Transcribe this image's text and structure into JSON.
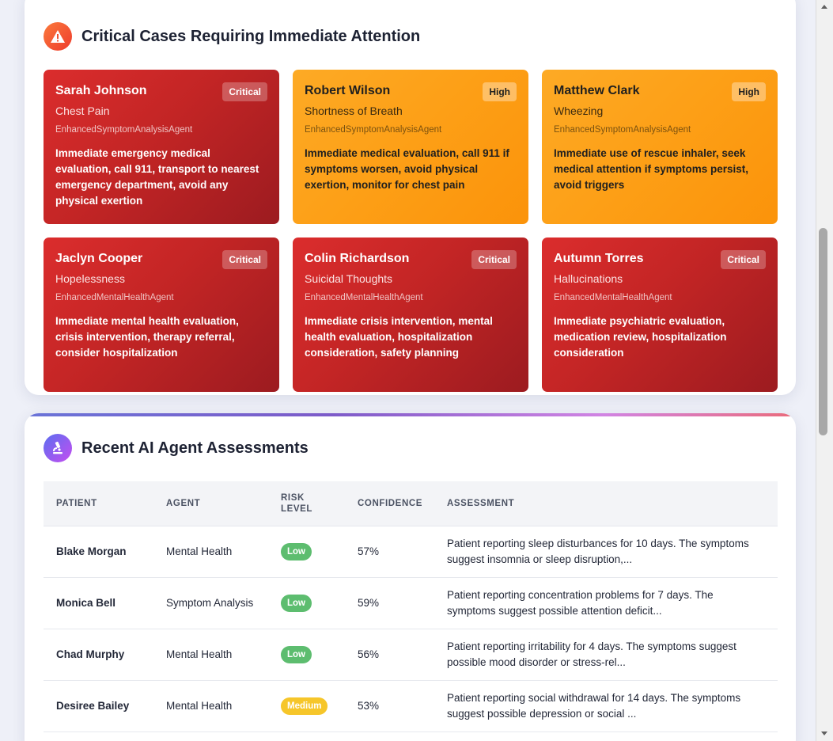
{
  "critical_panel": {
    "title": "Critical Cases Requiring Immediate Attention",
    "icon": "warning-icon",
    "cases": [
      {
        "name": "Sarah Johnson",
        "badge": "Critical",
        "symptom": "Chest Pain",
        "agent": "EnhancedSymptomAnalysisAgent",
        "action": "Immediate emergency medical evaluation, call 911, transport to nearest emergency department, avoid any physical exertion"
      },
      {
        "name": "Robert Wilson",
        "badge": "High",
        "symptom": "Shortness of Breath",
        "agent": "EnhancedSymptomAnalysisAgent",
        "action": "Immediate medical evaluation, call 911 if symptoms worsen, avoid physical exertion, monitor for chest pain"
      },
      {
        "name": "Matthew Clark",
        "badge": "High",
        "symptom": "Wheezing",
        "agent": "EnhancedSymptomAnalysisAgent",
        "action": "Immediate use of rescue inhaler, seek medical attention if symptoms persist, avoid triggers"
      },
      {
        "name": "Jaclyn Cooper",
        "badge": "Critical",
        "symptom": "Hopelessness",
        "agent": "EnhancedMentalHealthAgent",
        "action": "Immediate mental health evaluation, crisis intervention, therapy referral, consider hospitalization"
      },
      {
        "name": "Colin Richardson",
        "badge": "Critical",
        "symptom": "Suicidal Thoughts",
        "agent": "EnhancedMentalHealthAgent",
        "action": "Immediate crisis intervention, mental health evaluation, hospitalization consideration, safety planning"
      },
      {
        "name": "Autumn Torres",
        "badge": "Critical",
        "symptom": "Hallucinations",
        "agent": "EnhancedMentalHealthAgent",
        "action": "Immediate psychiatric evaluation, medication review, hospitalization consideration"
      }
    ]
  },
  "assessments_panel": {
    "title": "Recent AI Agent Assessments",
    "icon": "microscope-icon",
    "columns": [
      "PATIENT",
      "AGENT",
      "RISK LEVEL",
      "CONFIDENCE",
      "ASSESSMENT"
    ],
    "rows": [
      {
        "patient": "Blake Morgan",
        "agent": "Mental Health",
        "risk": "Low",
        "confidence": "57%",
        "assessment": "Patient reporting sleep disturbances for 10 days. The symptoms suggest insomnia or sleep disruption,..."
      },
      {
        "patient": "Monica Bell",
        "agent": "Symptom Analysis",
        "risk": "Low",
        "confidence": "59%",
        "assessment": "Patient reporting concentration problems for 7 days. The symptoms suggest possible attention deficit..."
      },
      {
        "patient": "Chad Murphy",
        "agent": "Mental Health",
        "risk": "Low",
        "confidence": "56%",
        "assessment": "Patient reporting irritability for 4 days. The symptoms suggest possible mood disorder or stress-rel..."
      },
      {
        "patient": "Desiree Bailey",
        "agent": "Mental Health",
        "risk": "Medium",
        "confidence": "53%",
        "assessment": "Patient reporting social withdrawal for 14 days. The symptoms suggest possible depression or social ..."
      }
    ]
  },
  "colors": {
    "critical": "#c32525",
    "high": "#fd9f16",
    "risk_low": "#5dbd6f",
    "risk_medium": "#f6c62a",
    "accent_gradient": [
      "#6a74d8",
      "#d184e3",
      "#ea6b7b"
    ]
  }
}
